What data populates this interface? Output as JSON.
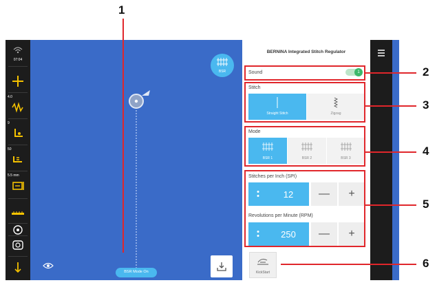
{
  "panel": {
    "title": "BERNINA Integrated Stitch Regulator",
    "sound": {
      "label": "Sound",
      "toggle_text": "1"
    },
    "stitch": {
      "label": "Stitch",
      "options": [
        {
          "label": "Straight Stitch",
          "selected": true
        },
        {
          "label": "Zigzag",
          "selected": false
        }
      ]
    },
    "mode": {
      "label": "Mode",
      "options": [
        {
          "label": "BSR 1",
          "selected": true
        },
        {
          "label": "BSR 2",
          "selected": false
        },
        {
          "label": "BSR 3",
          "selected": false
        }
      ]
    },
    "spi": {
      "label": "Stitches per Inch (SPI)",
      "value": "12"
    },
    "rpm": {
      "label": "Revolutions per Minute (RPM)",
      "value": "250"
    },
    "minus": "—",
    "plus": "+",
    "kickstart": {
      "label": "KickStart"
    }
  },
  "left_toolbar": {
    "time": "07:04",
    "item2_value": "4.0",
    "item3_value": "9",
    "item4_value": "50",
    "item5_value": "5.5 mm"
  },
  "canvas": {
    "bsr_label": "BSR",
    "mode_button": "BSR Mode On"
  },
  "callouts": [
    "1",
    "2",
    "3",
    "4",
    "5",
    "6"
  ],
  "colors": {
    "accent": "#4ab8ef",
    "canvas": "#3a6bc8",
    "callout_red": "#e0262b",
    "toolbar_icon": "#f5c200",
    "toggle_green": "#3cb86a"
  }
}
